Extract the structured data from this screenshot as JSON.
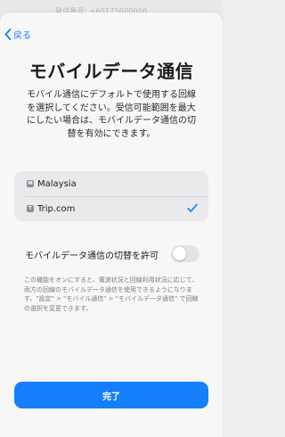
{
  "background_text": "発信番号: +60175000000",
  "nav": {
    "back_label": "戻る"
  },
  "page": {
    "title": "モバイルデータ通信",
    "description": "モバイル通信にデフォルトで使用する回線を選択してください。受信可能範囲を最大にしたい場合は、モバイルデータ通信の切替を有効にできます。"
  },
  "lines": {
    "items": [
      {
        "badge": "M",
        "label": "Malaysia",
        "selected": false
      },
      {
        "badge": "T",
        "label": "Trip.com",
        "selected": true
      }
    ]
  },
  "switching": {
    "label": "モバイルデータ通信の切替を許可",
    "enabled": false,
    "note": "この機能をオンにすると、電波状況と回線利用状況に応じて、両方の回線のモバイルデータ通信を使用できるようになります。\"設定\" > \"モバイル通信\" > \"モバイルデータ通信\" で回線の選択を変更できます。"
  },
  "footer": {
    "done_label": "完了"
  },
  "colors": {
    "accent": "#157efb",
    "sheet": "#f7f7f8",
    "group": "#eaeaec"
  }
}
